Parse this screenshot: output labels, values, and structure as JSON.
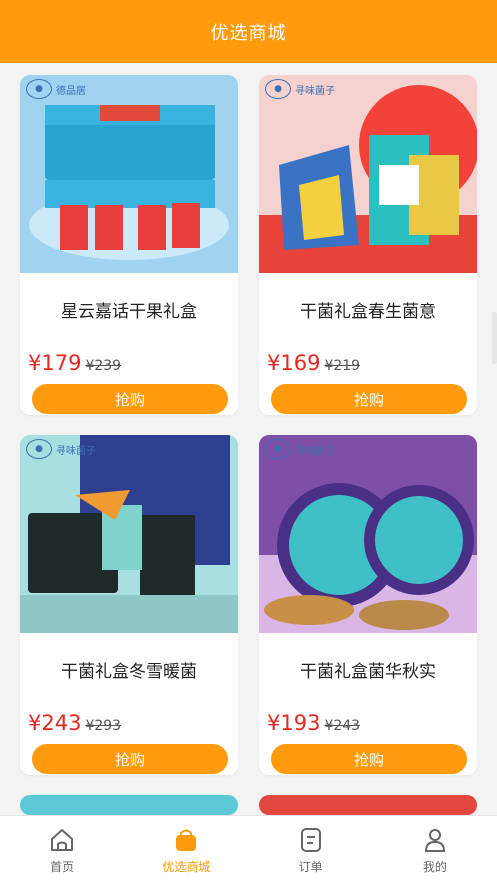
{
  "header": {
    "title": "优选商城"
  },
  "products": [
    {
      "title": "星云嘉话干果礼盒",
      "price": "¥179",
      "original_price": "¥239",
      "buy_label": "抢购",
      "logo_text": "德品居"
    },
    {
      "title": "干菌礼盒春生菌意",
      "price": "¥169",
      "original_price": "¥219",
      "buy_label": "抢购",
      "logo_text": "寻味菌子"
    },
    {
      "title": "干菌礼盒冬雪暖菌",
      "price": "¥243",
      "original_price": "¥293",
      "buy_label": "抢购",
      "logo_text": "寻味菌子"
    },
    {
      "title": "干菌礼盒菌华秋实",
      "price": "¥193",
      "original_price": "¥243",
      "buy_label": "抢购",
      "logo_text": "寻味菌子"
    }
  ],
  "tabbar": {
    "items": [
      {
        "label": "首页",
        "icon": "home-icon"
      },
      {
        "label": "优选商城",
        "icon": "shopping-bag-icon",
        "active": true
      },
      {
        "label": "订单",
        "icon": "order-icon"
      },
      {
        "label": "我的",
        "icon": "profile-icon"
      }
    ]
  },
  "colors": {
    "accent": "#ff9b0c",
    "price": "#e8261f"
  }
}
